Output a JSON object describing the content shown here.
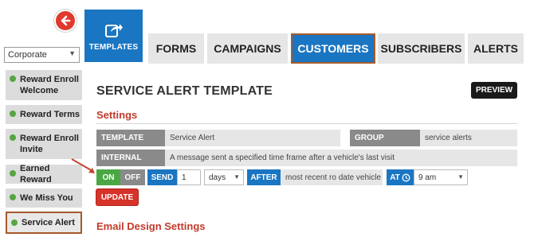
{
  "back": {
    "icon": "arrow-left-icon"
  },
  "templates_tile": {
    "label": "TEMPLATES",
    "icon": "share-icon"
  },
  "tabs": [
    {
      "label": "FORMS",
      "active": false
    },
    {
      "label": "CAMPAIGNS",
      "active": false
    },
    {
      "label": "CUSTOMERS",
      "active": true
    },
    {
      "label": "SUBSCRIBERS",
      "active": false
    },
    {
      "label": "ALERTS",
      "active": false
    }
  ],
  "company_select": {
    "value": "Corporate"
  },
  "sidebar": {
    "items": [
      {
        "label_line1": "Reward Enroll",
        "label_line2": "Welcome",
        "status": "active-dot"
      },
      {
        "label_line1": "Reward Terms",
        "label_line2": "",
        "status": "active-dot"
      },
      {
        "label_line1": "Reward Enroll",
        "label_line2": "Invite",
        "status": "active-dot"
      },
      {
        "label_line1": "Earned Reward",
        "label_line2": "",
        "status": "active-dot"
      },
      {
        "label_line1": "We Miss You",
        "label_line2": "",
        "status": "active-dot"
      },
      {
        "label_line1": "Service Alert",
        "label_line2": "",
        "status": "active-dot",
        "selected": true
      }
    ]
  },
  "main": {
    "title": "SERVICE ALERT TEMPLATE",
    "preview_label": "PREVIEW",
    "settings_heading": "Settings",
    "template_label": "TEMPLATE",
    "template_value": "Service Alert",
    "group_label": "GROUP",
    "group_value": "service alerts",
    "internal_label": "INTERNAL",
    "internal_value": "A message sent a specified time frame after a vehicle's last visit",
    "on_label": "ON",
    "off_label": "OFF",
    "send_label": "SEND",
    "send_value": "1",
    "unit_value": "days",
    "after_label": "AFTER",
    "after_value": "most recent ro date vehicle",
    "at_label": "AT",
    "time_value": "9 am",
    "update_label": "UPDATE",
    "email_heading": "Email Design Settings"
  },
  "colors": {
    "brand_blue": "#1a76c2",
    "accent_red": "#d6342a",
    "status_green": "#55a642",
    "highlight_border": "#a55a2b"
  }
}
